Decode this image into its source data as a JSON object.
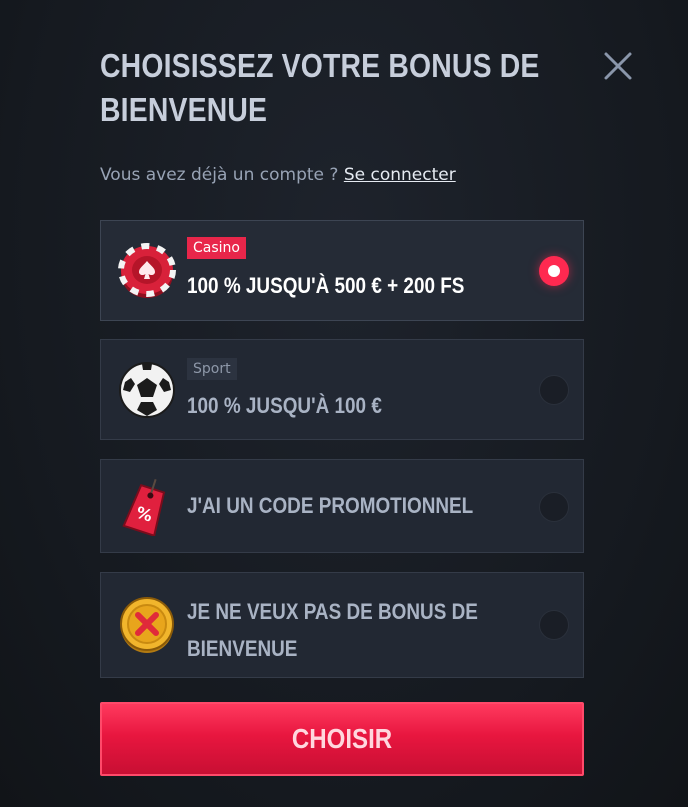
{
  "modal": {
    "title": "CHOISISSEZ VOTRE BONUS DE BIENVENUE",
    "login_prompt": "Vous avez déjà un compte ?",
    "login_link": "Se connecter",
    "close_icon": "close-icon"
  },
  "options": [
    {
      "tag": "Casino",
      "label": "100 % JUSQU'À 500 € + 200 FS",
      "icon": "casino-chip-icon",
      "selected": true
    },
    {
      "tag": "Sport",
      "label": "100 % JUSQU'À 100 €",
      "icon": "soccer-ball-icon",
      "selected": false
    },
    {
      "label": "J'AI UN CODE PROMOTIONNEL",
      "icon": "promo-tag-icon",
      "selected": false
    },
    {
      "label_line1": "JE NE VEUX PAS DE BONUS DE",
      "label_line2": "BIENVENUE",
      "icon": "no-bonus-coin-icon",
      "selected": false
    }
  ],
  "submit": {
    "label": "CHOISIR"
  },
  "colors": {
    "accent": "#ff2950",
    "background": "#171b22",
    "card": "#222833"
  }
}
